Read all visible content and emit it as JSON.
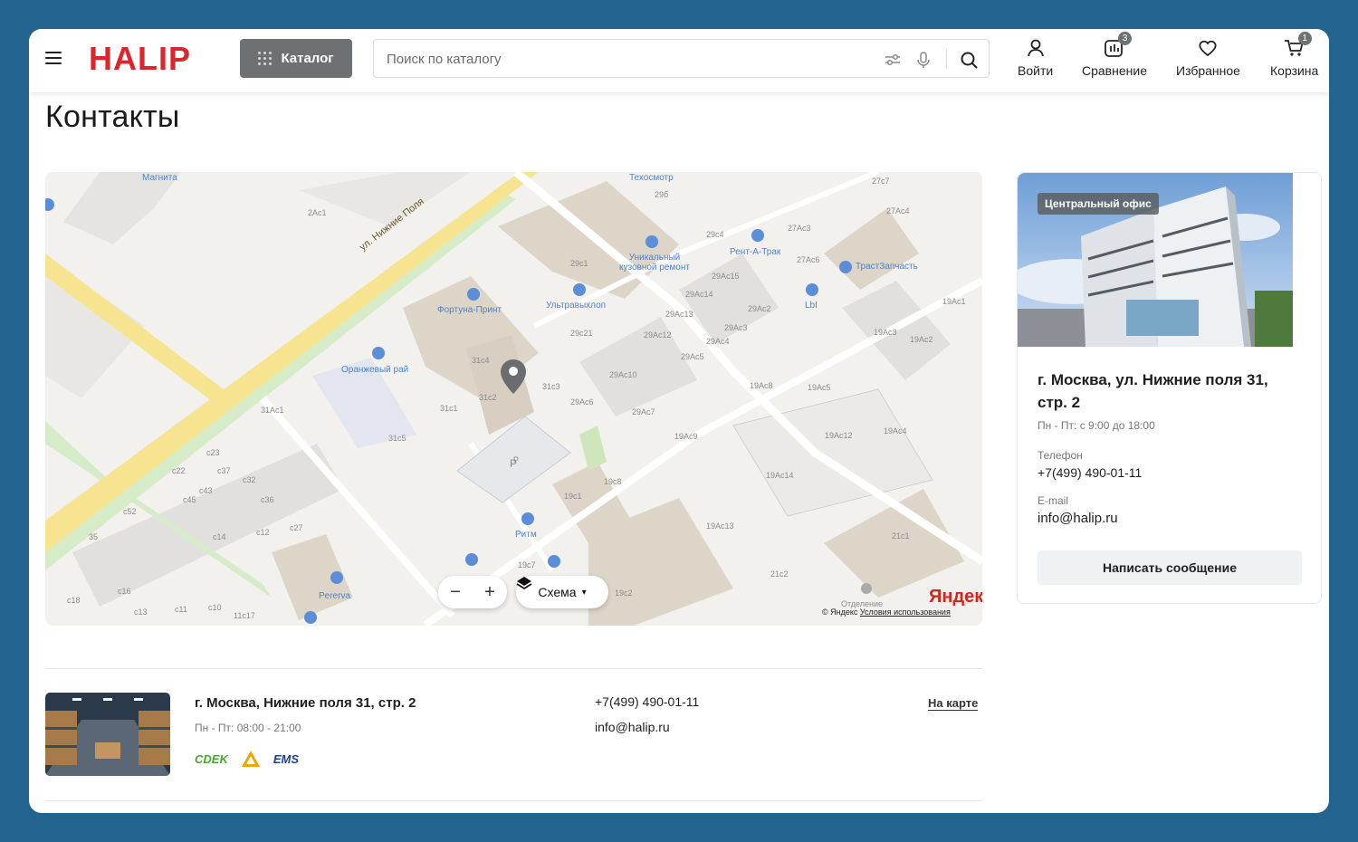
{
  "header": {
    "logo": "HALIP",
    "catalog_label": "Каталог",
    "search_placeholder": "Поиск по каталогу",
    "actions": [
      {
        "label": "Войти",
        "icon": "user-icon"
      },
      {
        "label": "Сравнение",
        "icon": "compare-icon",
        "badge": "3"
      },
      {
        "label": "Избранное",
        "icon": "heart-icon"
      },
      {
        "label": "Корзина",
        "icon": "cart-icon",
        "badge": "1"
      }
    ]
  },
  "page_title": "Контакты",
  "map": {
    "street_label": "ул. Нижние Поля",
    "scheme_label": "Схема",
    "zoom_out": "−",
    "zoom_in": "+",
    "brand": "Яндекс",
    "copyright": "© Яндекс",
    "terms": "Условия использования",
    "pois": [
      "Магнита",
      "Техосмотр",
      "Уникальный кузовной ремонт",
      "Рент-А-Трак",
      "ТрастЗапчасть",
      "Фортуна-Принт",
      "Ультравыхлоп",
      "LbI",
      "Оранжевый рай",
      "Ритм",
      "Pererva",
      "Отделение"
    ],
    "buildings": [
      "2Ac1",
      "29б",
      "27c7",
      "27Ac4",
      "29c4",
      "27Ac3",
      "29c1",
      "27Ac6",
      "29Ac15",
      "29Ac14",
      "29Ac2",
      "19Ac1",
      "29Ac13",
      "29c21",
      "29Ac12",
      "29Ac3",
      "29Ac4",
      "19Ac3",
      "19Ac2",
      "31c4",
      "29Ac5",
      "29Ac10",
      "31c3",
      "19Ac8",
      "19Ac5",
      "31c2",
      "29Ac6",
      "31c1",
      "31Ac1",
      "29Ac7",
      "19Ac9",
      "19Ac12",
      "19Ac4",
      "31c5",
      "c23",
      "c22",
      "c37",
      "c32",
      "c43",
      "c36",
      "c45",
      "c52",
      "35",
      "c14",
      "c12",
      "c27",
      "19c1",
      "19c8",
      "19Ac14",
      "19Ac13",
      "21c1",
      "21c2",
      "19c7",
      "19c2",
      "c18",
      "c16",
      "c13",
      "c11",
      "c10",
      "11c17",
      "P"
    ]
  },
  "office": {
    "tag": "Центральный офис",
    "address": "г. Москва, ул. Нижние поля 31, стр. 2",
    "hours": "Пн - Пт: с 9:00 до 18:00",
    "phone_label": "Телефон",
    "phone": "+7(499) 490-01-11",
    "email_label": "E-mail",
    "email": "info@halip.ru",
    "button": "Написать сообщение"
  },
  "store": {
    "address": "г. Москва, Нижние поля 31, стр. 2",
    "hours": "Пн - Пт: 08:00 - 21:00",
    "phone": "+7(499) 490-01-11",
    "email": "info@halip.ru",
    "on_map": "На карте",
    "carriers": [
      "CDEK",
      "EMS"
    ]
  },
  "colors": {
    "brand": "#d9272e",
    "background": "#22648f",
    "catalog_button": "#6d7172",
    "poi": "#4f82c8",
    "road": "#f6e491"
  }
}
